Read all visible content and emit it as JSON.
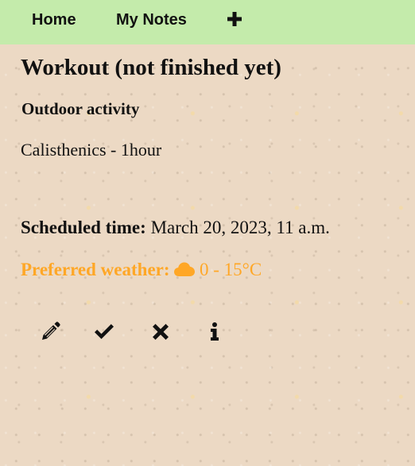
{
  "nav": {
    "home_label": "Home",
    "notes_label": "My Notes",
    "add_icon": "plus-icon"
  },
  "note": {
    "title": "Workout (not finished yet)",
    "category": "Outdoor activity",
    "body": "Calisthenics - 1hour",
    "scheduled_label": "Scheduled time:",
    "scheduled_value": "March 20, 2023, 11 a.m.",
    "weather_label": "Preferred weather:",
    "weather_icon": "cloud-icon",
    "weather_value": "0 - 15°C"
  },
  "actions": [
    {
      "icon": "pencil-icon"
    },
    {
      "icon": "check-icon"
    },
    {
      "icon": "close-icon"
    },
    {
      "icon": "info-icon"
    }
  ],
  "colors": {
    "navbar_bg": "#c4ebab",
    "weather_accent": "#ffa726",
    "text": "#111111"
  }
}
